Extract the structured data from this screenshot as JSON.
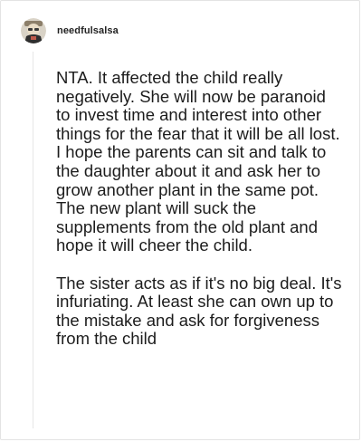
{
  "post": {
    "author": {
      "username": "needfulsalsa",
      "avatar_icon": "avatar-icon"
    },
    "paragraphs": [
      "NTA. It affected the child really negatively. She will now be paranoid to invest time and interest into other things for the fear that it will be all lost. I hope the parents can sit and talk to the daughter about it and ask her to grow another plant in the same pot. The new plant will suck the supplements from the old plant and hope it will cheer the child.",
      "The sister acts as if it's no big deal. It's infuriating. At least she can own up to the mistake and ask for forgiveness from the child"
    ]
  },
  "colors": {
    "text": "#1c1c1c",
    "border": "#e3e3e3",
    "thread_line": "#e6e6e6",
    "background": "#ffffff"
  }
}
